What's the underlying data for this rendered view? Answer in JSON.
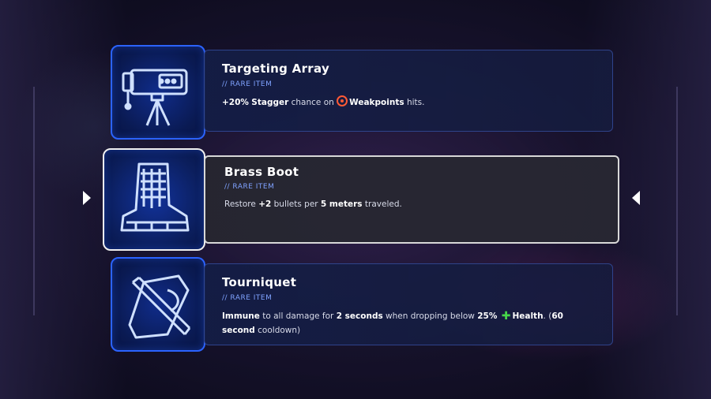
{
  "items": [
    {
      "name": "Targeting Array",
      "rarity": "// RARE ITEM",
      "icon": "camera-tripod-icon",
      "desc": {
        "t1": "+20%",
        "t2": " ",
        "t3": "Stagger",
        "t4": " chance on ",
        "t5": "Weakpoints",
        "t6": " hits."
      }
    },
    {
      "name": "Brass Boot",
      "rarity": "// RARE ITEM",
      "icon": "boot-icon",
      "desc": {
        "t1": "Restore ",
        "t2": "+2",
        "t3": " bullets per ",
        "t4": "5 meters",
        "t5": " traveled."
      }
    },
    {
      "name": "Tourniquet",
      "rarity": "// RARE ITEM",
      "icon": "tourniquet-icon",
      "desc": {
        "t1": "Immune",
        "t2": " to all damage for ",
        "t3": "2 seconds",
        "t4": " when dropping below ",
        "t5": "25%",
        "t6": "Health",
        "t7": ". (",
        "t8": "60",
        "t9": "second",
        "t10": " cooldown)"
      }
    }
  ],
  "selected_index": 1,
  "colors": {
    "accent_blue": "#2b63ff",
    "rarity_blue": "#7fa2ff",
    "weakpoint_red": "#ff5a36",
    "health_green": "#47d64a"
  }
}
